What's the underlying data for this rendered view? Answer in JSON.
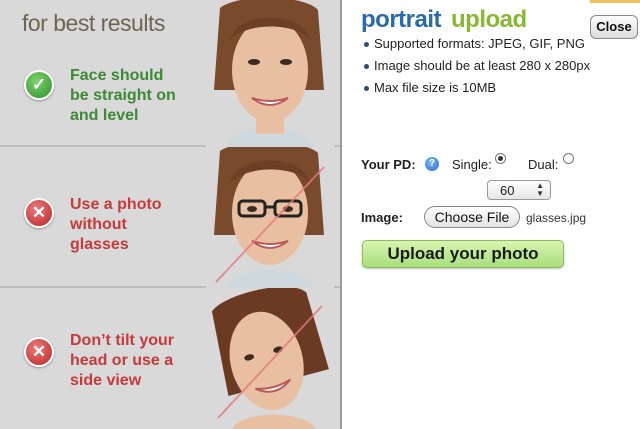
{
  "left_panel": {
    "title": "for best results",
    "tips": [
      {
        "icon": "check-icon",
        "status": "good",
        "text": "Face should be straight on and level",
        "lines": [
          "Face should",
          "be straight on",
          "and level"
        ]
      },
      {
        "icon": "cross-icon",
        "status": "bad",
        "text": "Use a photo without glasses",
        "lines": [
          "Use a photo",
          "without",
          "glasses"
        ]
      },
      {
        "icon": "cross-icon",
        "status": "bad",
        "text": "Don't tilt your head or use a side view",
        "lines": [
          "Don’t tilt your",
          "head or use a",
          "side view"
        ]
      }
    ],
    "colors": {
      "good": "#3c8a35",
      "bad": "#c83a3a",
      "panel_bg": "#d9d9d9"
    }
  },
  "header": {
    "brand_word1": "portrait",
    "brand_word2": "upload",
    "close_label": "Close"
  },
  "requirements": [
    "Supported formats: JPEG, GIF, PNG",
    "Image should be at least 280 x 280px",
    "Max file size is 10MB"
  ],
  "pd": {
    "label": "Your PD:",
    "help_icon": "?",
    "single_label": "Single:",
    "dual_label": "Dual:",
    "selected_mode": "Single",
    "value": "60"
  },
  "image": {
    "label": "Image:",
    "choose_file_label": "Choose File",
    "file_name": "glasses.jpg"
  },
  "upload_label": "Upload your photo"
}
